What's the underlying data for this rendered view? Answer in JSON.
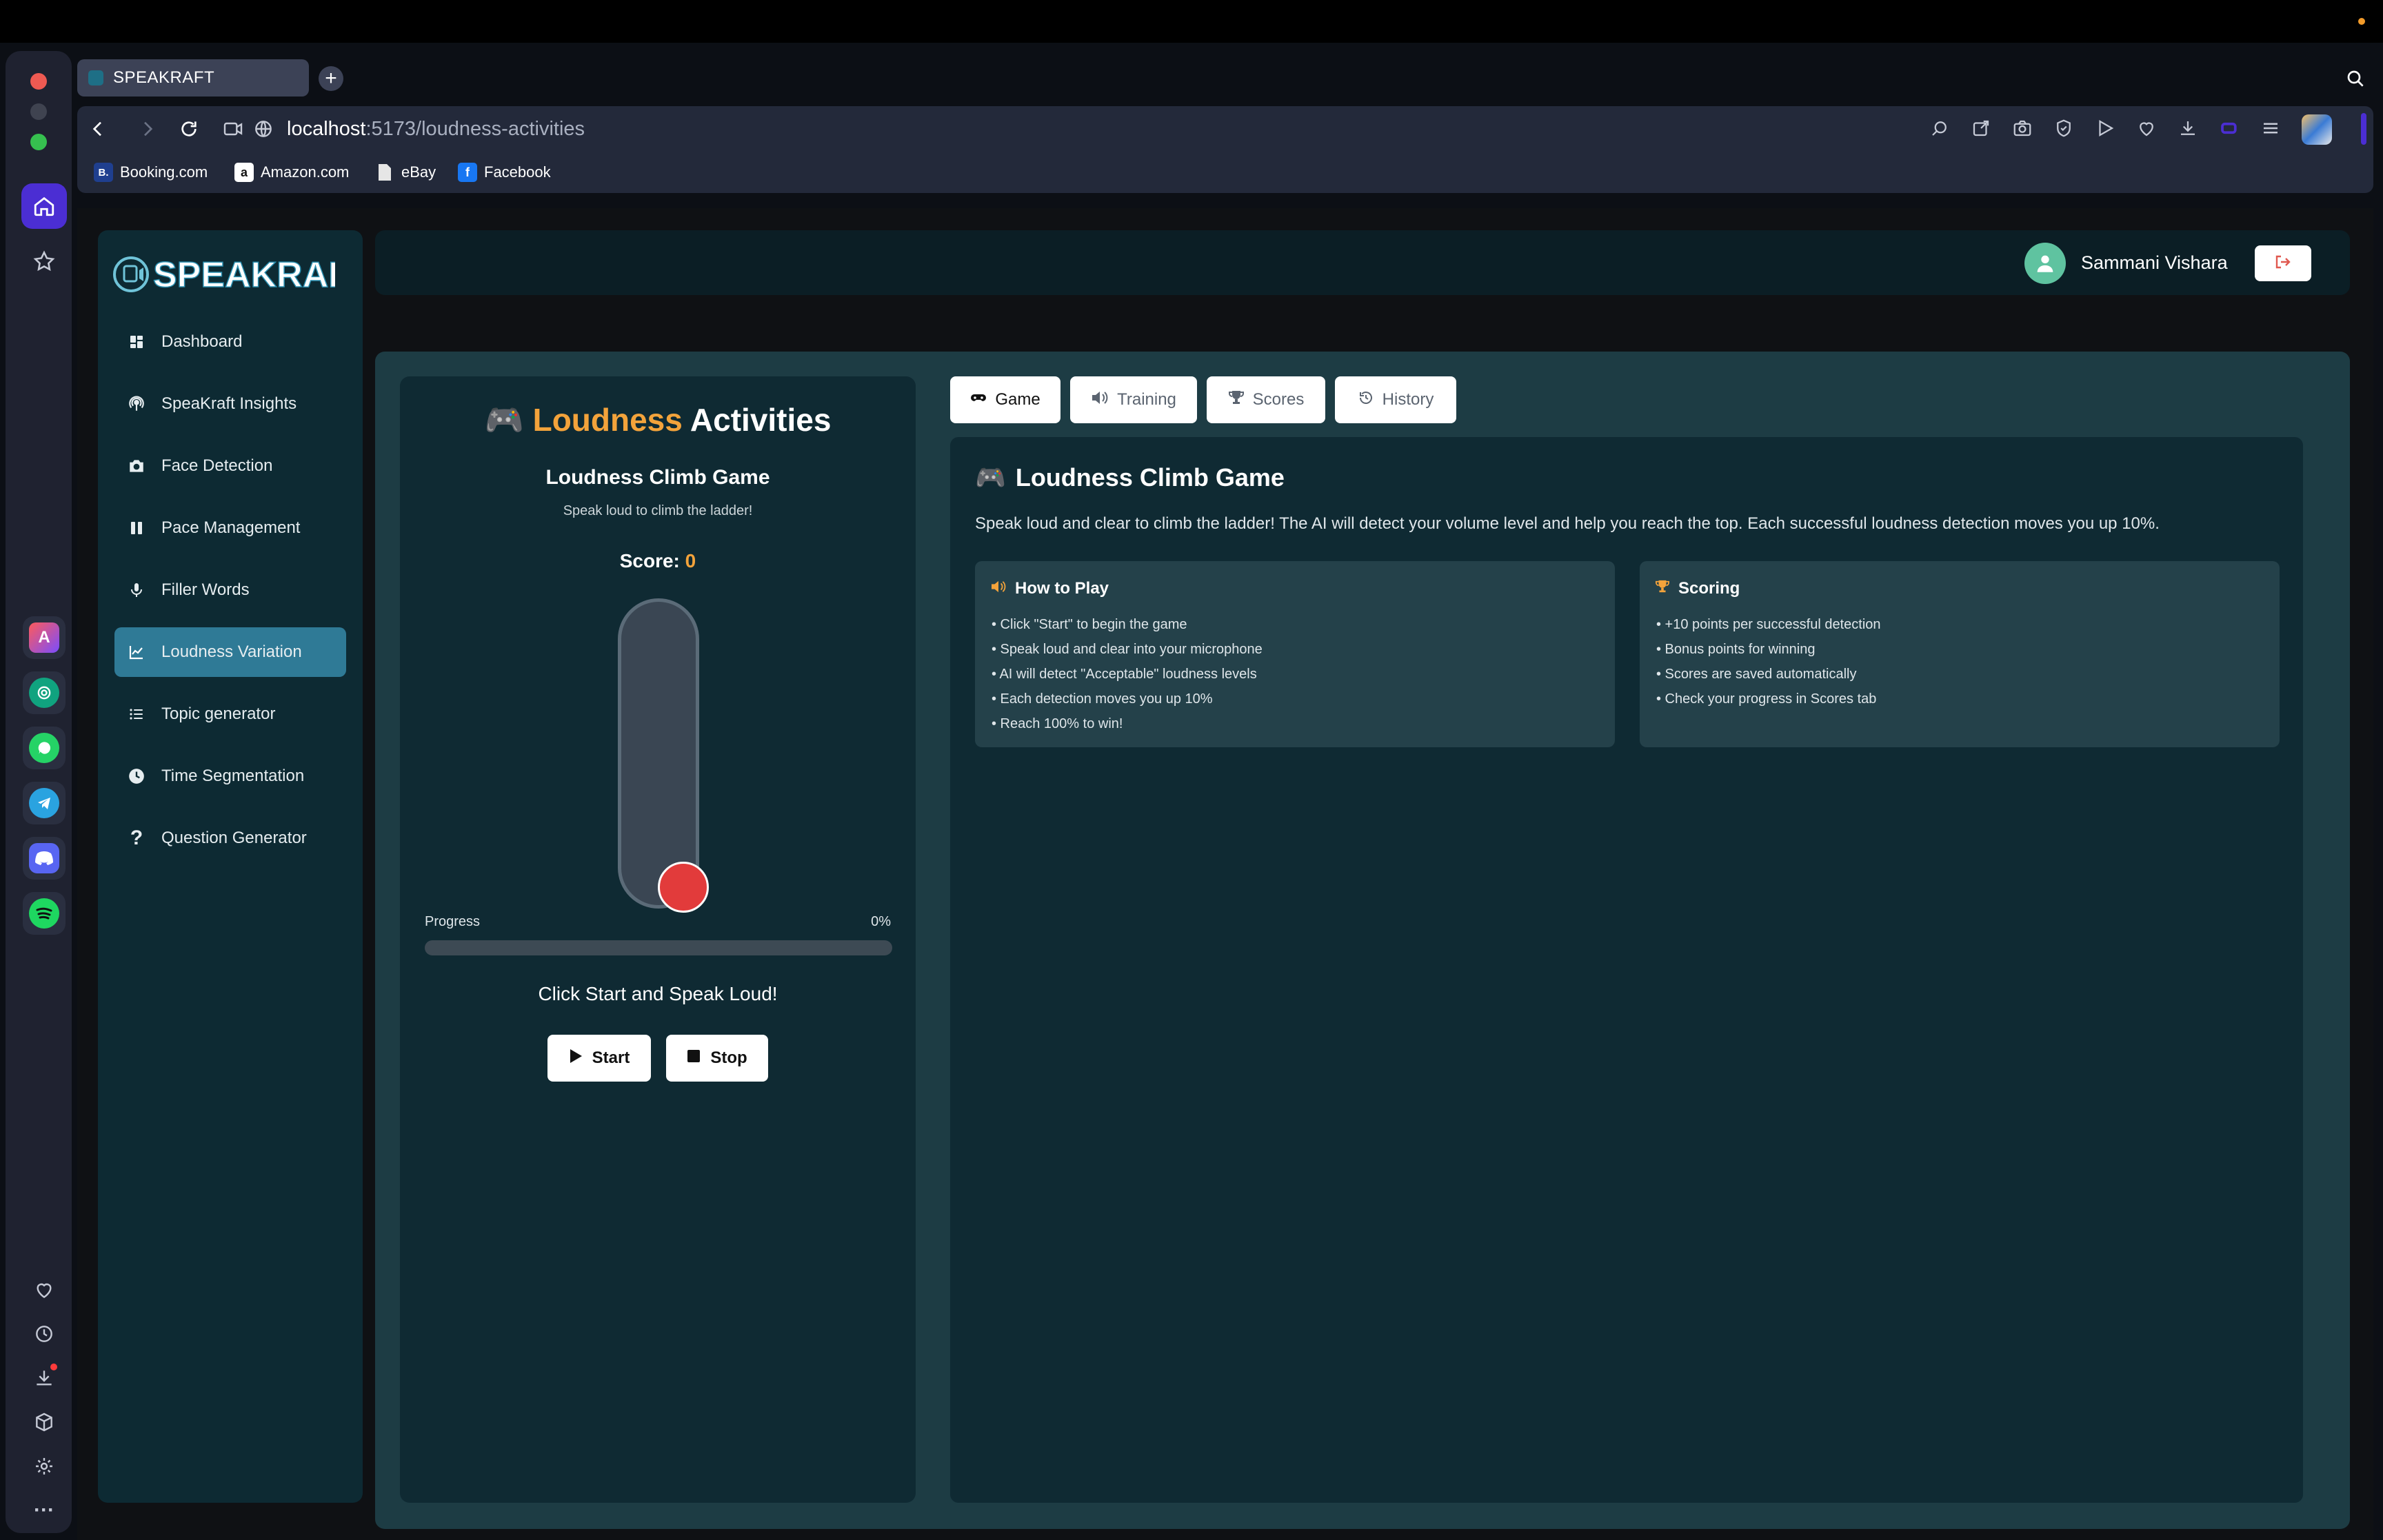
{
  "browser": {
    "tab_title": "SPEAKRAFT",
    "new_tab": "+",
    "url_host": "localhost",
    "url_path": ":5173/loudness-activities",
    "bookmarks": [
      {
        "label": "Booking.com",
        "icon": "B."
      },
      {
        "label": "Amazon.com",
        "icon": "a"
      },
      {
        "label": "eBay",
        "icon": ""
      },
      {
        "label": "Facebook",
        "icon": "f"
      }
    ]
  },
  "sidebar": {
    "logo_text": "SPEAKRAFT",
    "items": [
      {
        "label": "Dashboard",
        "icon": "dashboard-icon"
      },
      {
        "label": "SpeaKraft Insights",
        "icon": "podcast-icon"
      },
      {
        "label": "Face Detection",
        "icon": "camera-icon"
      },
      {
        "label": "Pace Management",
        "icon": "pause-icon"
      },
      {
        "label": "Filler Words",
        "icon": "microphone-icon"
      },
      {
        "label": "Loudness Variation",
        "icon": "chart-line-icon",
        "active": true
      },
      {
        "label": "Topic generator",
        "icon": "list-icon"
      },
      {
        "label": "Time Segmentation",
        "icon": "clock-icon"
      },
      {
        "label": "Question Generator",
        "icon": "question-icon"
      }
    ]
  },
  "header": {
    "user_name": "Sammani Vishara"
  },
  "activity": {
    "title_emoji": "🎮",
    "title_accent": "Loudness",
    "title_rest": "Activities",
    "game_title": "Loudness Climb Game",
    "game_subtitle": "Speak loud to climb the ladder!",
    "score_label": "Score:",
    "score_value": "0",
    "progress_label": "Progress",
    "progress_text": "0%",
    "progress_fraction": 0,
    "status_message": "Click Start and Speak Loud!",
    "start_label": "Start",
    "stop_label": "Stop"
  },
  "tabs": [
    {
      "label": "Game",
      "icon": "gamepad-icon",
      "active": true
    },
    {
      "label": "Training",
      "icon": "volume-icon"
    },
    {
      "label": "Scores",
      "icon": "trophy-icon"
    },
    {
      "label": "History",
      "icon": "history-icon"
    }
  ],
  "game_panel": {
    "title_emoji": "🎮",
    "title": "Loudness Climb Game",
    "description": "Speak loud and clear to climb the ladder! The AI will detect your volume level and help you reach the top. Each successful loudness detection moves you up 10%.",
    "how_to_play": {
      "title": "How to Play",
      "items": [
        "• Click \"Start\" to begin the game",
        "• Speak loud and clear into your microphone",
        "• AI will detect \"Acceptable\" loudness levels",
        "• Each detection moves you up 10%",
        "• Reach 100% to win!"
      ]
    },
    "scoring": {
      "title": "Scoring",
      "items": [
        "• +10 points per successful detection",
        "• Bonus points for winning",
        "• Scores are saved automatically",
        "• Check your progress in Scores tab"
      ]
    }
  },
  "colors": {
    "accent": "#f3a33b",
    "active_nav": "#2f7a96",
    "ball": "#e23b3b",
    "avatar": "#5fc3a0"
  }
}
